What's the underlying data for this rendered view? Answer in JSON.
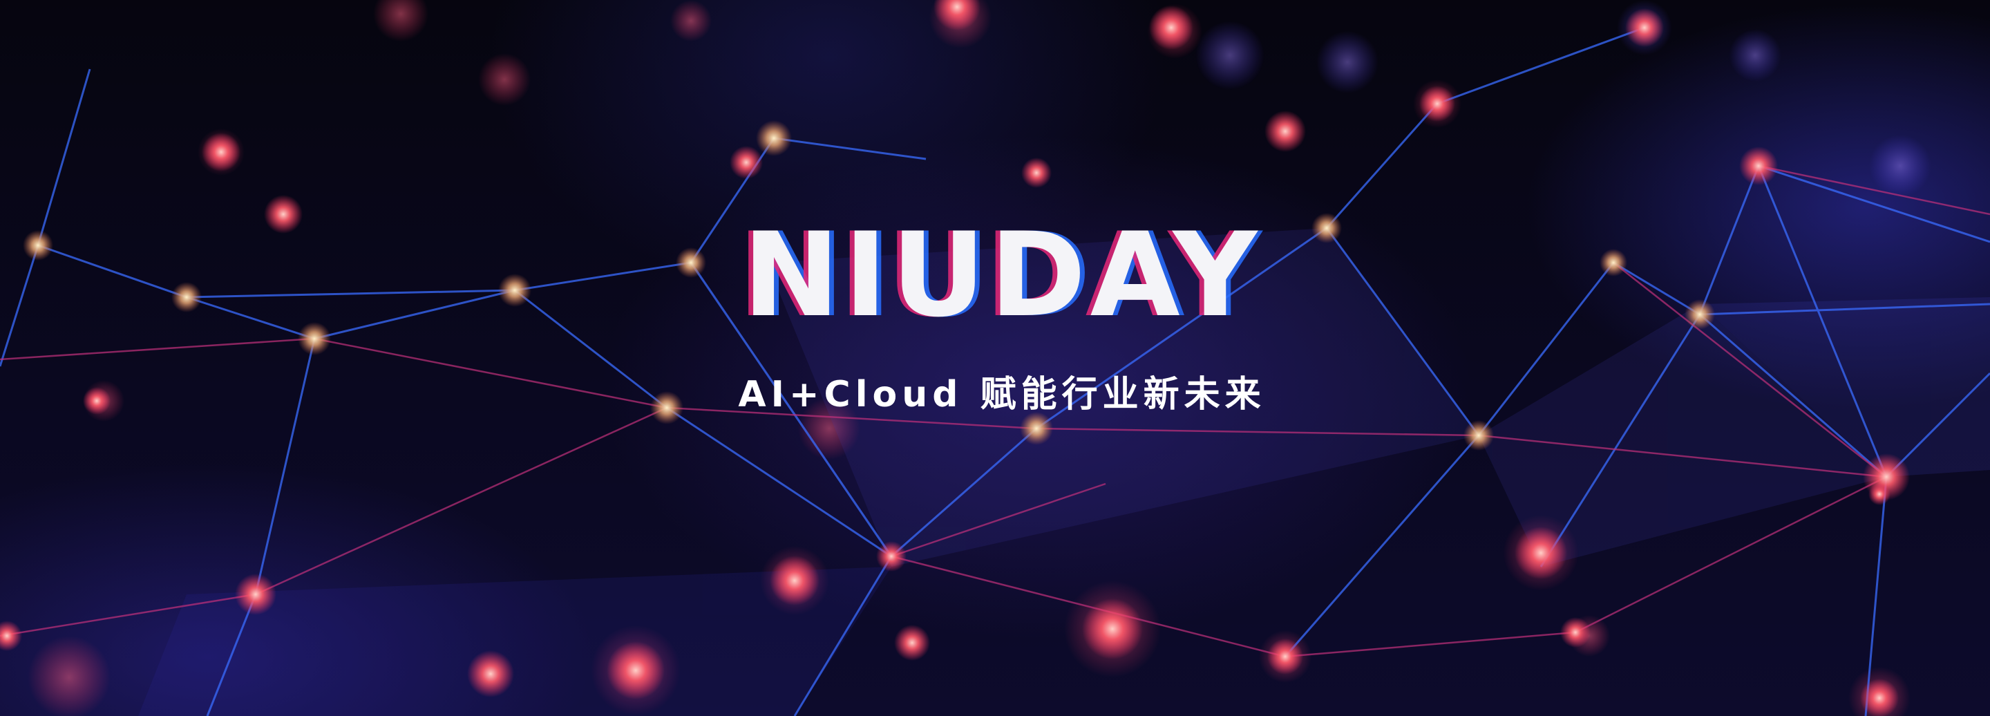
{
  "banner": {
    "logo_text": "NIUDAY",
    "tagline": "AI+Cloud 赋能行业新未来"
  },
  "colors": {
    "background": "#05040d",
    "line_blue": "#3a6cff",
    "line_magenta": "#c0307a",
    "node_glow": "#ff5a6a",
    "text": "#ffffff"
  }
}
